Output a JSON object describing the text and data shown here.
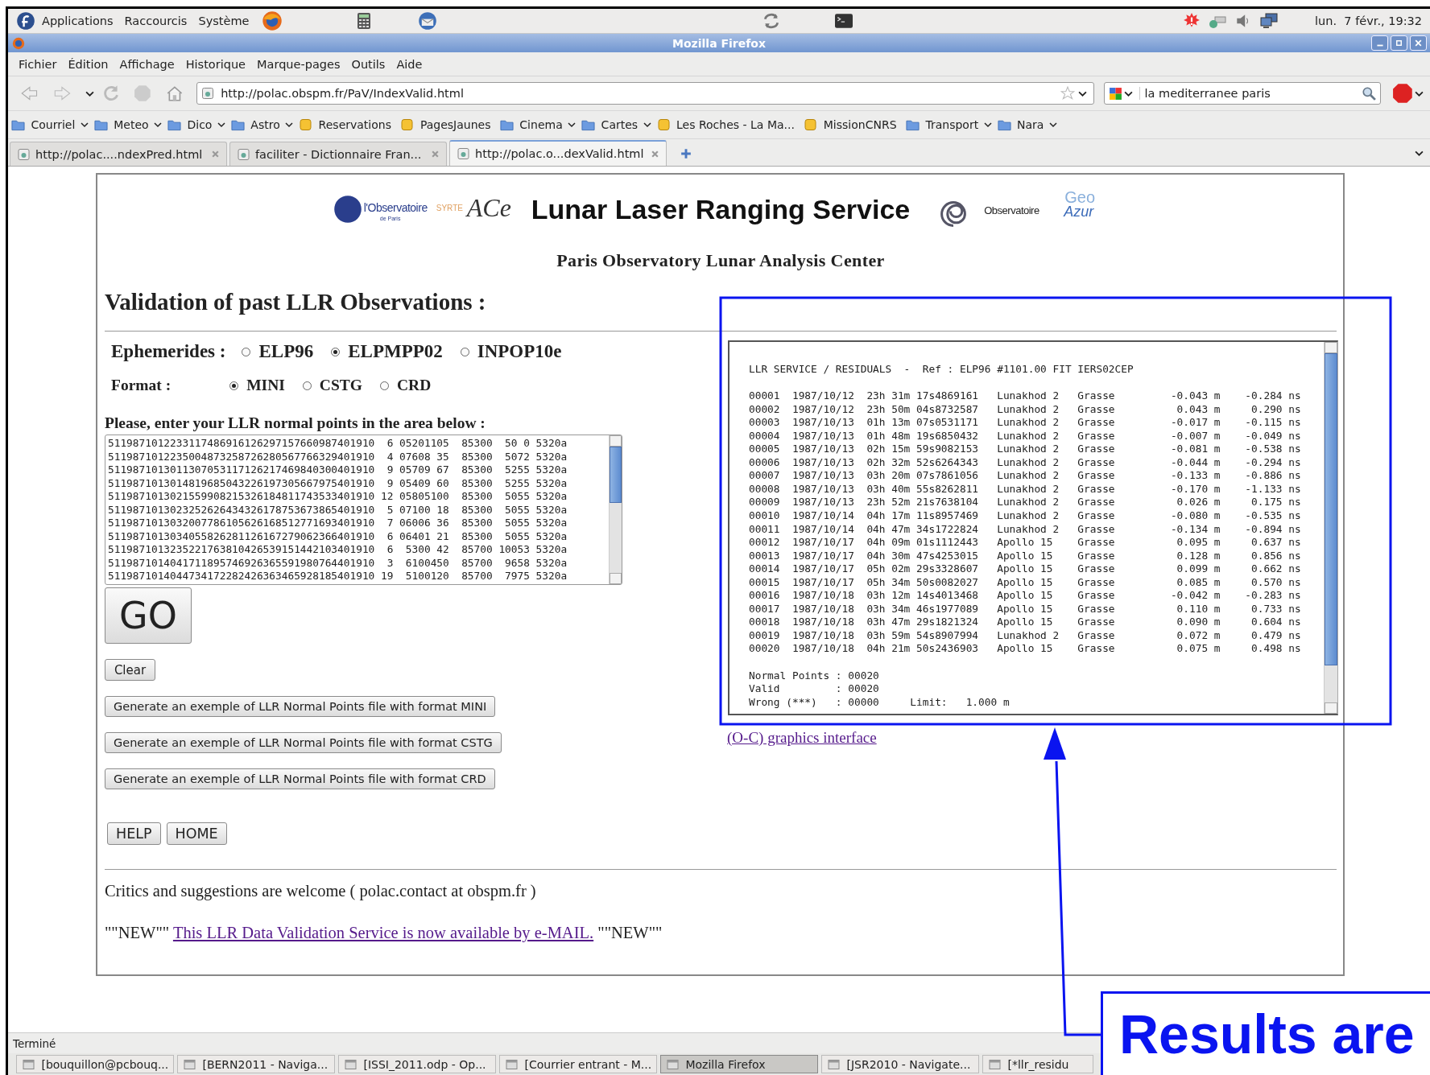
{
  "panel": {
    "menus": [
      "Applications",
      "Raccourcis",
      "Système"
    ],
    "clock": "lun.  7 févr., 19:32"
  },
  "window": {
    "title": "Mozilla Firefox"
  },
  "menu_bar": [
    "Fichier",
    "Édition",
    "Affichage",
    "Historique",
    "Marque-pages",
    "Outils",
    "Aide"
  ],
  "navigation": {
    "url": "http://polac.obspm.fr/PaV/IndexValid.html",
    "search_value": "la mediterranee paris"
  },
  "bookmarks": [
    {
      "label": "Courriel",
      "kind": "folder"
    },
    {
      "label": "Meteo",
      "kind": "folder"
    },
    {
      "label": "Dico",
      "kind": "folder"
    },
    {
      "label": "Astro",
      "kind": "folder"
    },
    {
      "label": "Reservations",
      "kind": "link"
    },
    {
      "label": "PagesJaunes",
      "kind": "link"
    },
    {
      "label": "Cinema",
      "kind": "folder"
    },
    {
      "label": "Cartes",
      "kind": "folder"
    },
    {
      "label": "Les Roches - La Ma...",
      "kind": "link"
    },
    {
      "label": "MissionCNRS",
      "kind": "link"
    },
    {
      "label": "Transport",
      "kind": "folder"
    },
    {
      "label": "Nara",
      "kind": "folder"
    }
  ],
  "tabs": [
    {
      "label": "http://polac....ndexPred.html",
      "selected": false
    },
    {
      "label": "faciliter - Dictionnaire Fran...",
      "selected": false
    },
    {
      "label": "http://polac.o...dexValid.html",
      "selected": true
    }
  ],
  "page": {
    "logos": {
      "left_name": "l'Observatoire",
      "left_sub": "de Paris",
      "left_lab": "SYRTE",
      "left_script": "ACe",
      "right_name": "Observatoire",
      "right_brand": "Geo",
      "right_brand2": "Azur"
    },
    "title": "Lunar Laser Ranging Service",
    "subtitle": "Paris Observatory Lunar Analysis Center",
    "heading": "Validation of past LLR Observations :",
    "ephemerides": {
      "label": "Ephemerides :",
      "options": [
        {
          "label": "ELP96",
          "selected": false
        },
        {
          "label": "ELPMPP02",
          "selected": true
        },
        {
          "label": "INPOP10e",
          "selected": false
        }
      ]
    },
    "format": {
      "label": "Format :",
      "options": [
        {
          "label": "MINI",
          "selected": true
        },
        {
          "label": "CSTG",
          "selected": false
        },
        {
          "label": "CRD",
          "selected": false
        }
      ]
    },
    "input_label": "Please, enter your LLR normal points in the area below :",
    "input_lines": [
      "5119871012233117486916126297157660987401910  6 05201105  85300  50 0 5320a",
      "5119871012235004873258726280567766329401910  4 07608 35  85300  5072 5320a",
      "5119871013011307053117126217469840300401910  9 05709 67  85300  5255 5320a",
      "5119871013014819685043226197305667975401910  9 05409 60  85300  5255 5320a",
      "5119871013021559908215326184811743533401910 12 05805100  85300  5055 5320a",
      "5119871013023252626434326178753673865401910  5 07100 18  85300  5055 5320a",
      "5119871013032007786105626168512771693401910  7 06006 36  85300  5055 5320a",
      "5119871013034055826281126167279062366401910  6 06401 21  85300  5055 5320a",
      "5119871013235221763810426539151442103401910  6  5300 42  85700 10053 5320a",
      "5119871014041711895746926365591980764401910  3  6100450  85700  9658 5320a",
      "5119871014044734172282426363465928185401910 19  5100120  85700  7975 5320a"
    ],
    "go_button": "GO",
    "clear_button": "Clear",
    "example_buttons": [
      "Generate an exemple of LLR Normal Points file with format MINI",
      "Generate an exemple of LLR Normal Points file with format CSTG",
      "Generate an exemple of LLR Normal Points file with format CRD"
    ],
    "nav_buttons": [
      "HELP",
      "HOME"
    ],
    "results": {
      "header": "LLR SERVICE / RESIDUALS  -  Ref : ELP96 #1101.00 FIT IERS02CEP",
      "rows": [
        "00001  1987/10/12  23h 31m 17s4869161   Lunakhod 2   Grasse         -0.043 m    -0.284 ns",
        "00002  1987/10/12  23h 50m 04s8732587   Lunakhod 2   Grasse          0.043 m     0.290 ns",
        "00003  1987/10/13  01h 13m 07s0531171   Lunakhod 2   Grasse         -0.017 m    -0.115 ns",
        "00004  1987/10/13  01h 48m 19s6850432   Lunakhod 2   Grasse         -0.007 m    -0.049 ns",
        "00005  1987/10/13  02h 15m 59s9082153   Lunakhod 2   Grasse         -0.081 m    -0.538 ns",
        "00006  1987/10/13  02h 32m 52s6264343   Lunakhod 2   Grasse         -0.044 m    -0.294 ns",
        "00007  1987/10/13  03h 20m 07s7861056   Lunakhod 2   Grasse         -0.133 m    -0.886 ns",
        "00008  1987/10/13  03h 40m 55s8262811   Lunakhod 2   Grasse         -0.170 m    -1.133 ns",
        "00009  1987/10/13  23h 52m 21s7638104   Lunakhod 2   Grasse          0.026 m     0.175 ns",
        "00010  1987/10/14  04h 17m 11s8957469   Lunakhod 2   Grasse         -0.080 m    -0.535 ns",
        "00011  1987/10/14  04h 47m 34s1722824   Lunakhod 2   Grasse         -0.134 m    -0.894 ns",
        "00012  1987/10/17  04h 09m 01s1112443   Apollo 15    Grasse          0.095 m     0.637 ns",
        "00013  1987/10/17  04h 30m 47s4253015   Apollo 15    Grasse          0.128 m     0.856 ns",
        "00014  1987/10/17  05h 02m 29s3328607   Apollo 15    Grasse          0.099 m     0.662 ns",
        "00015  1987/10/17  05h 34m 50s0082027   Apollo 15    Grasse          0.085 m     0.570 ns",
        "00016  1987/10/18  03h 12m 14s4013468   Apollo 15    Grasse         -0.042 m    -0.283 ns",
        "00017  1987/10/18  03h 34m 46s1977089   Apollo 15    Grasse          0.110 m     0.733 ns",
        "00018  1987/10/18  03h 47m 29s1821324   Apollo 15    Grasse          0.090 m     0.604 ns",
        "00019  1987/10/18  03h 59m 54s8907994   Lunakhod 2   Grasse          0.072 m     0.479 ns",
        "00020  1987/10/18  04h 21m 50s2436903   Apollo 15    Grasse          0.075 m     0.498 ns"
      ],
      "summary": [
        "Normal Points : 00020",
        "Valid         : 00020",
        "Wrong (***)   : 00000     Limit:   1.000 m"
      ]
    },
    "graphics_link": "(O-C) graphics interface",
    "critics": "Critics and suggestions are welcome ( polac.contact at obspm.fr )",
    "notice": {
      "before": "\"\"NEW\"\"",
      "link": "This LLR Data Validation Service is now available by e-MAIL.",
      "after": "\"\"NEW\"\""
    }
  },
  "status_bar": "Terminé",
  "taskbar": [
    {
      "label": "[bouquillon@pcbouq...",
      "selected": false
    },
    {
      "label": "[BERN2011 - Naviga...",
      "selected": false
    },
    {
      "label": "[ISSI_2011.odp - Op...",
      "selected": false
    },
    {
      "label": "[Courrier entrant - M...",
      "selected": false
    },
    {
      "label": "Mozilla Firefox",
      "selected": true
    },
    {
      "label": "[JSR2010 - Navigate...",
      "selected": false
    },
    {
      "label": "[*llr_residu",
      "selected": false
    }
  ],
  "annotation": {
    "text": "Results are"
  }
}
